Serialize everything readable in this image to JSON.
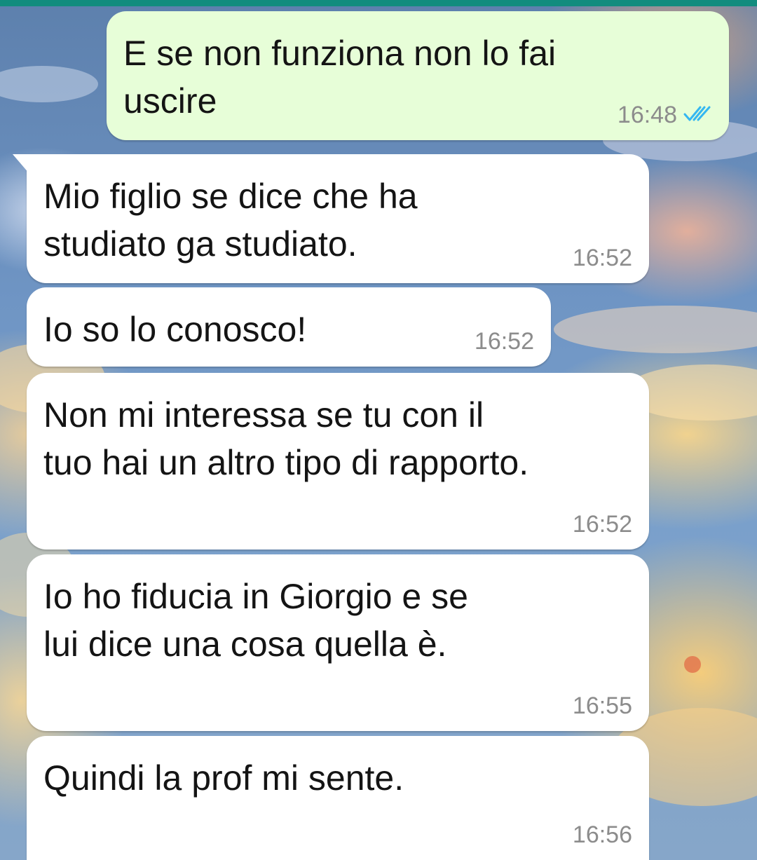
{
  "theme": {
    "outgoing_bubble": "#e7fed8",
    "incoming_bubble": "#ffffff",
    "read_tick": "#34b7f1",
    "header_strip": "#128c7e"
  },
  "messages": [
    {
      "direction": "outgoing",
      "text": "E se non funziona non lo fai\nuscire",
      "time": "16:48",
      "status": "read",
      "status_icon": "double-check-icon"
    },
    {
      "direction": "incoming",
      "text": "Mio figlio se dice che ha\nstudiato ga studiato.",
      "time": "16:52"
    },
    {
      "direction": "incoming",
      "text": "Io so lo conosco!",
      "time": "16:52"
    },
    {
      "direction": "incoming",
      "text": "Non mi interessa se tu con il\ntuo hai un altro tipo di rapporto.",
      "time": "16:52"
    },
    {
      "direction": "incoming",
      "text": "Io ho fiducia in Giorgio e se\nlui dice una cosa quella è.",
      "time": "16:55"
    },
    {
      "direction": "incoming",
      "text": "Quindi la prof mi sente.",
      "time": "16:56"
    }
  ]
}
